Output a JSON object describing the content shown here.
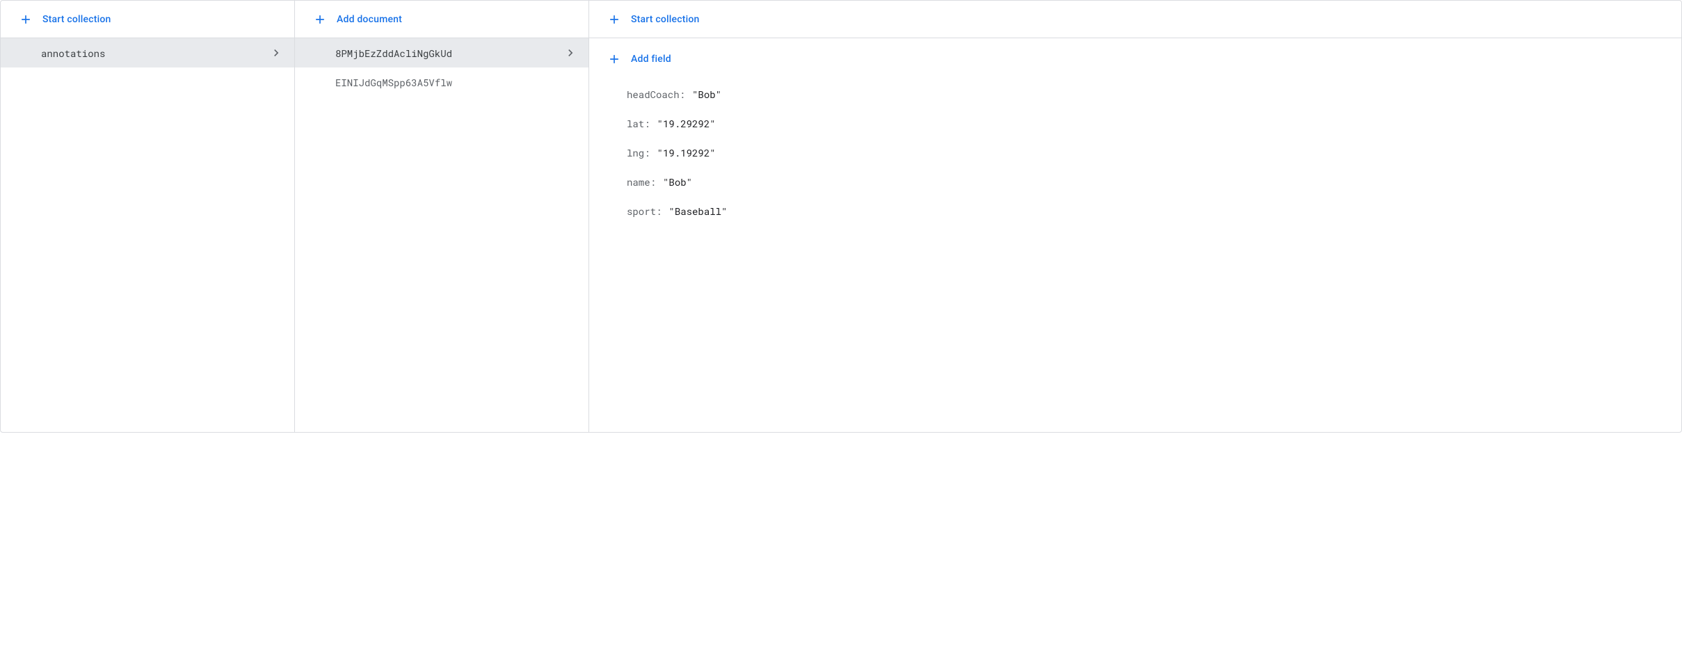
{
  "panels": {
    "collections": {
      "header_label": "Start collection",
      "items": [
        {
          "label": "annotations",
          "selected": true
        }
      ]
    },
    "documents": {
      "header_label": "Add document",
      "items": [
        {
          "label": "8PMjbEzZddAcliNgGkUd",
          "selected": true
        },
        {
          "label": "EINIJdGqMSpp63A5Vflw",
          "selected": false
        }
      ]
    },
    "fields": {
      "header_label": "Start collection",
      "add_field_label": "Add field",
      "items": [
        {
          "key": "headCoach",
          "value": "\"Bob\""
        },
        {
          "key": "lat",
          "value": "\"19.29292\""
        },
        {
          "key": "lng",
          "value": "\"19.19292\""
        },
        {
          "key": "name",
          "value": "\"Bob\""
        },
        {
          "key": "sport",
          "value": "\"Baseball\""
        }
      ]
    }
  }
}
